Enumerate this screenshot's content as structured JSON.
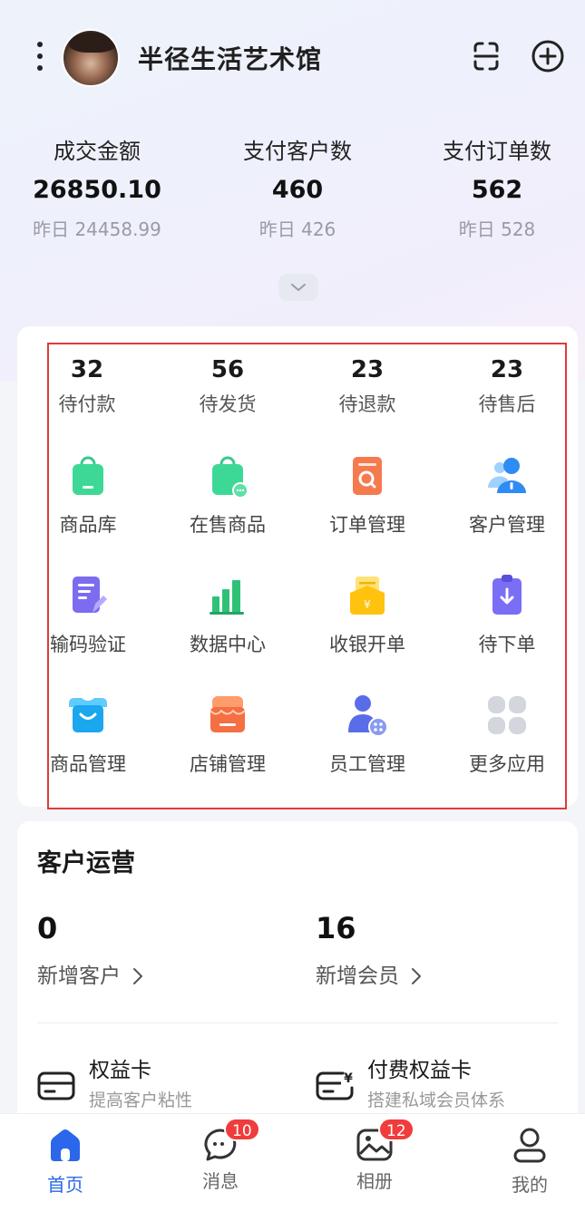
{
  "header": {
    "store_name": "半径生活艺术馆",
    "menu_icon": "more-vertical-icon",
    "scan_icon": "scan-icon",
    "add_icon": "plus-circle-icon"
  },
  "stats": [
    {
      "label": "成交金额",
      "value": "26850.10",
      "yesterday": "昨日 24458.99"
    },
    {
      "label": "支付客户数",
      "value": "460",
      "yesterday": "昨日 426"
    },
    {
      "label": "支付订单数",
      "value": "562",
      "yesterday": "昨日 528"
    }
  ],
  "todos": [
    {
      "count": "32",
      "label": "待付款"
    },
    {
      "count": "56",
      "label": "待发货"
    },
    {
      "count": "23",
      "label": "待退款"
    },
    {
      "count": "23",
      "label": "待售后"
    }
  ],
  "apps": [
    {
      "label": "商品库",
      "icon": "shopping-bag-icon"
    },
    {
      "label": "在售商品",
      "icon": "bag-on-sale-icon"
    },
    {
      "label": "订单管理",
      "icon": "order-search-icon"
    },
    {
      "label": "客户管理",
      "icon": "customers-icon"
    },
    {
      "label": "输码验证",
      "icon": "code-verify-icon"
    },
    {
      "label": "数据中心",
      "icon": "bar-chart-icon"
    },
    {
      "label": "收银开单",
      "icon": "cashier-wallet-icon"
    },
    {
      "label": "待下单",
      "icon": "clipboard-download-icon"
    },
    {
      "label": "商品管理",
      "icon": "basket-icon"
    },
    {
      "label": "店铺管理",
      "icon": "storefront-icon"
    },
    {
      "label": "员工管理",
      "icon": "staff-icon"
    },
    {
      "label": "更多应用",
      "icon": "more-apps-icon"
    }
  ],
  "customer_ops": {
    "title": "客户运营",
    "new_customers": {
      "value": "0",
      "label": "新增客户"
    },
    "new_members": {
      "value": "16",
      "label": "新增会员"
    },
    "features": [
      {
        "title": "权益卡",
        "subtitle": "提高客户粘性",
        "icon": "card-icon"
      },
      {
        "title": "付费权益卡",
        "subtitle": "搭建私域会员体系",
        "icon": "paid-card-icon"
      }
    ]
  },
  "tabbar": [
    {
      "label": "首页",
      "icon": "home-icon",
      "active": true
    },
    {
      "label": "消息",
      "icon": "message-icon",
      "badge": "10"
    },
    {
      "label": "相册",
      "icon": "album-icon",
      "badge": "12"
    },
    {
      "label": "我的",
      "icon": "profile-icon"
    }
  ],
  "colors": {
    "accent": "#2a67ea",
    "badge": "#f03c3c",
    "highlight_border": "#e03a3a"
  }
}
